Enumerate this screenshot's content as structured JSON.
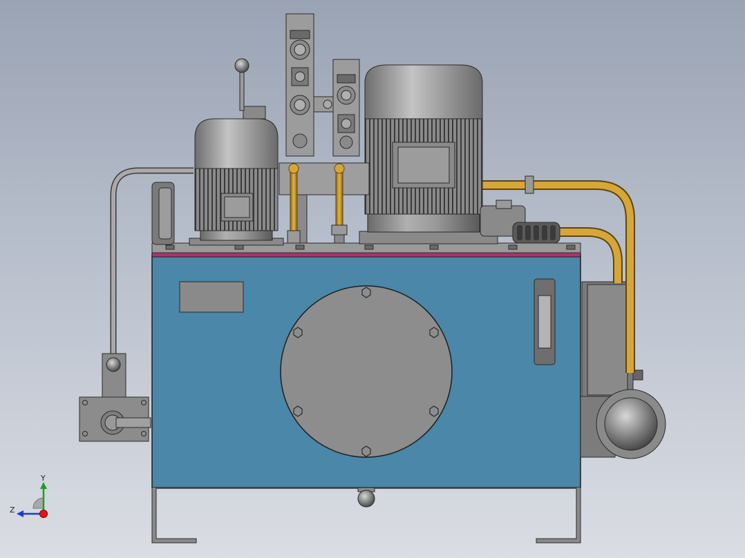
{
  "view": {
    "triad": {
      "x_label": "",
      "y_label": "Y",
      "z_label": "Z"
    }
  },
  "colors": {
    "background_top": "#9aa3b4",
    "background_bottom": "#dadde3",
    "tank_blue": "#4a87a8",
    "tank_rim": "#a8356e",
    "machine_gray": "#8c8c8c",
    "dark_gray": "#5c5c5c",
    "pipe_brass": "#c89a2a",
    "outline": "#2a2a2a"
  },
  "scene": {
    "components": [
      "oil-tank",
      "motor-pump-left",
      "motor-pump-right",
      "valve-stack",
      "cleanout-cover",
      "oil-level-gauge",
      "pressure-gauge",
      "accumulator",
      "return-filter",
      "hand-pump-lever"
    ]
  }
}
